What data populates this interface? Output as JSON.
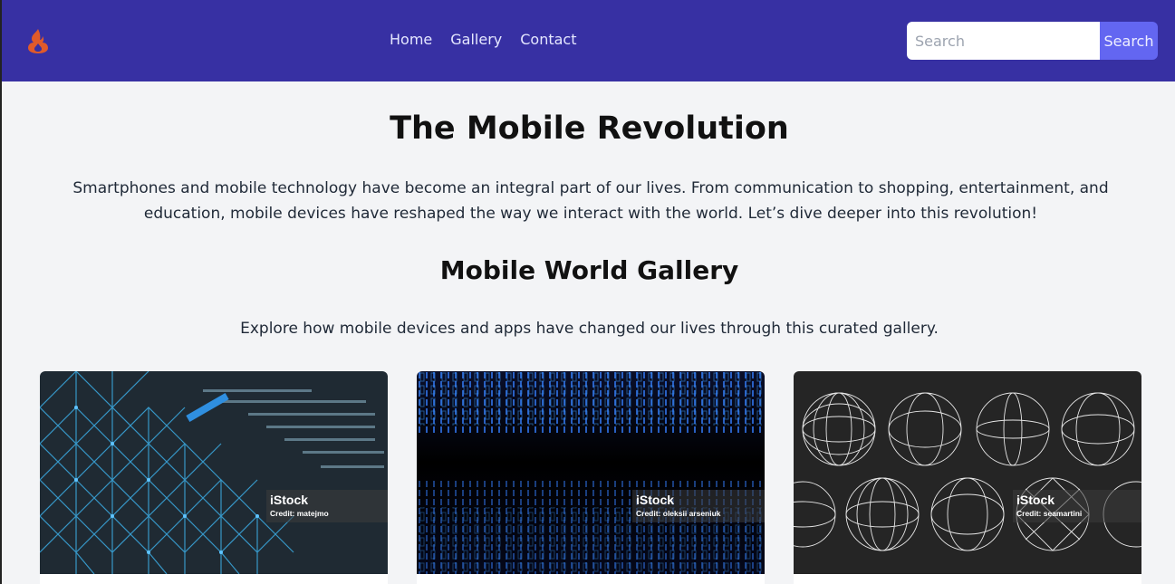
{
  "nav": {
    "logo_icon": "flame-logo-icon",
    "links": [
      "Home",
      "Gallery",
      "Contact"
    ],
    "search": {
      "placeholder": "Search",
      "button_label": "Search"
    }
  },
  "main": {
    "title": "The Mobile Revolution",
    "intro": "Smartphones and mobile technology have become an integral part of our lives. From communication to shopping, entertainment, and education, mobile devices have reshaped the way we interact with the world. Let’s dive deeper into this revolution!",
    "gallery_title": "Mobile World Gallery",
    "gallery_subtitle": "Explore how mobile devices and apps have changed our lives through this curated gallery."
  },
  "gallery": [
    {
      "brand": "iStock",
      "credit": "Credit: matejmo"
    },
    {
      "brand": "iStock",
      "credit": "Credit: oleksii arseniuk"
    },
    {
      "brand": "iStock",
      "credit": "Credit: seamartini"
    }
  ],
  "colors": {
    "nav_bg": "#3730a3",
    "search_button": "#6366f1",
    "page_bg": "#f3f4f6"
  }
}
